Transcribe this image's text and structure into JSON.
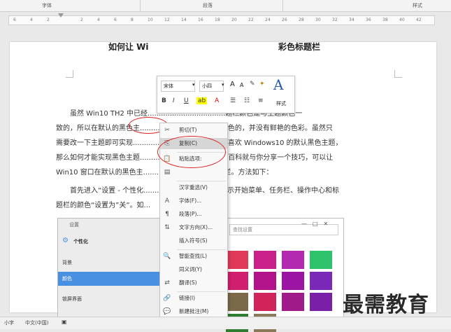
{
  "ribbon": {
    "groups": [
      "字体",
      "段落",
      "样式"
    ]
  },
  "ruler": {
    "ticks": [
      "6",
      "4",
      "2",
      "",
      "2",
      "4",
      "6",
      "8",
      "10",
      "12",
      "14",
      "16",
      "18",
      "20",
      "22",
      "24",
      "26",
      "28",
      "30",
      "32",
      "34",
      "36",
      "38",
      "40",
      "42"
    ]
  },
  "document": {
    "title_left": "如何让 Wi",
    "title_right": "彩色标题栏",
    "para1": [
      "虽然 Win10 TH2 中已经...................................题栏颜色是与主题颜色一",
      "致的，所以在默认的黑色主...........................依然是白色的，并没有鲜艳的色彩。虽然只",
      "需要改一下主题即可实现...........................朋友却又很喜欢 Windows10 的默认黑色主题，",
      "那么如何才能实现黑色主题........................？下面文章百科就与你分享一个技巧，可以让",
      "Win10 窗口在默认的黑色主...........................的标题栏。方法如下："
    ],
    "para2": [
      "首先进入“设置 - 个性化.........................”，把“显示开始菜单、任务栏、操作中心和标",
      "题栏的颜色“设置为”关”。如..."
    ]
  },
  "mini_toolbar": {
    "font": "宋体",
    "size": "小四",
    "styles_label": "样式"
  },
  "context_menu": {
    "items": [
      {
        "icon": "scissors-icon",
        "glyph": "✂",
        "label": "剪切(T)"
      },
      {
        "icon": "copy-icon",
        "glyph": "⎘",
        "label": "复制(C)",
        "highlight": true
      },
      {
        "icon": "paste-icon",
        "glyph": "📋",
        "label": "粘贴选项:"
      },
      {
        "icon": "paste-option-icon",
        "glyph": "▤",
        "label": ""
      },
      {
        "icon": "none",
        "glyph": "",
        "label": "汉字重选(V)"
      },
      {
        "icon": "font-icon",
        "glyph": "A",
        "label": "字体(F)..."
      },
      {
        "icon": "paragraph-icon",
        "glyph": "¶",
        "label": "段落(P)..."
      },
      {
        "icon": "text-direction-icon",
        "glyph": "⇅",
        "label": "文字方向(X)..."
      },
      {
        "icon": "none",
        "glyph": "",
        "label": "插入符号(S)"
      },
      {
        "icon": "smart-lookup-icon",
        "glyph": "🔍",
        "label": "智能查找(L)"
      },
      {
        "icon": "none",
        "glyph": "",
        "label": "同义词(Y)"
      },
      {
        "icon": "translate-icon",
        "glyph": "⇄",
        "label": "翻译(S)"
      },
      {
        "icon": "link-icon",
        "glyph": "🔗",
        "label": "链接(I)"
      },
      {
        "icon": "new-comment-icon",
        "glyph": "💬",
        "label": "新建批注(M)"
      }
    ]
  },
  "settings_shot": {
    "window_title": "设置",
    "home_label": "个性化",
    "search_placeholder": "查找设置",
    "side_items": [
      "背景",
      "颜色",
      "锁屏界面"
    ],
    "selected": "颜色",
    "swatches": [
      "#e03a5a",
      "#c9208a",
      "#b32ab0",
      "#2cc36b",
      "#cf1f6e",
      "#b2138a",
      "#9b14a3",
      "#7a28b8",
      "#7b6a4a",
      "#d0245a",
      "#a01a8a",
      "#7a1fa8",
      "#2e7d32",
      "#8a7a5a"
    ]
  },
  "statusbar": {
    "left": "小字",
    "lang": "中文(中国)"
  },
  "watermark": "最需教育"
}
